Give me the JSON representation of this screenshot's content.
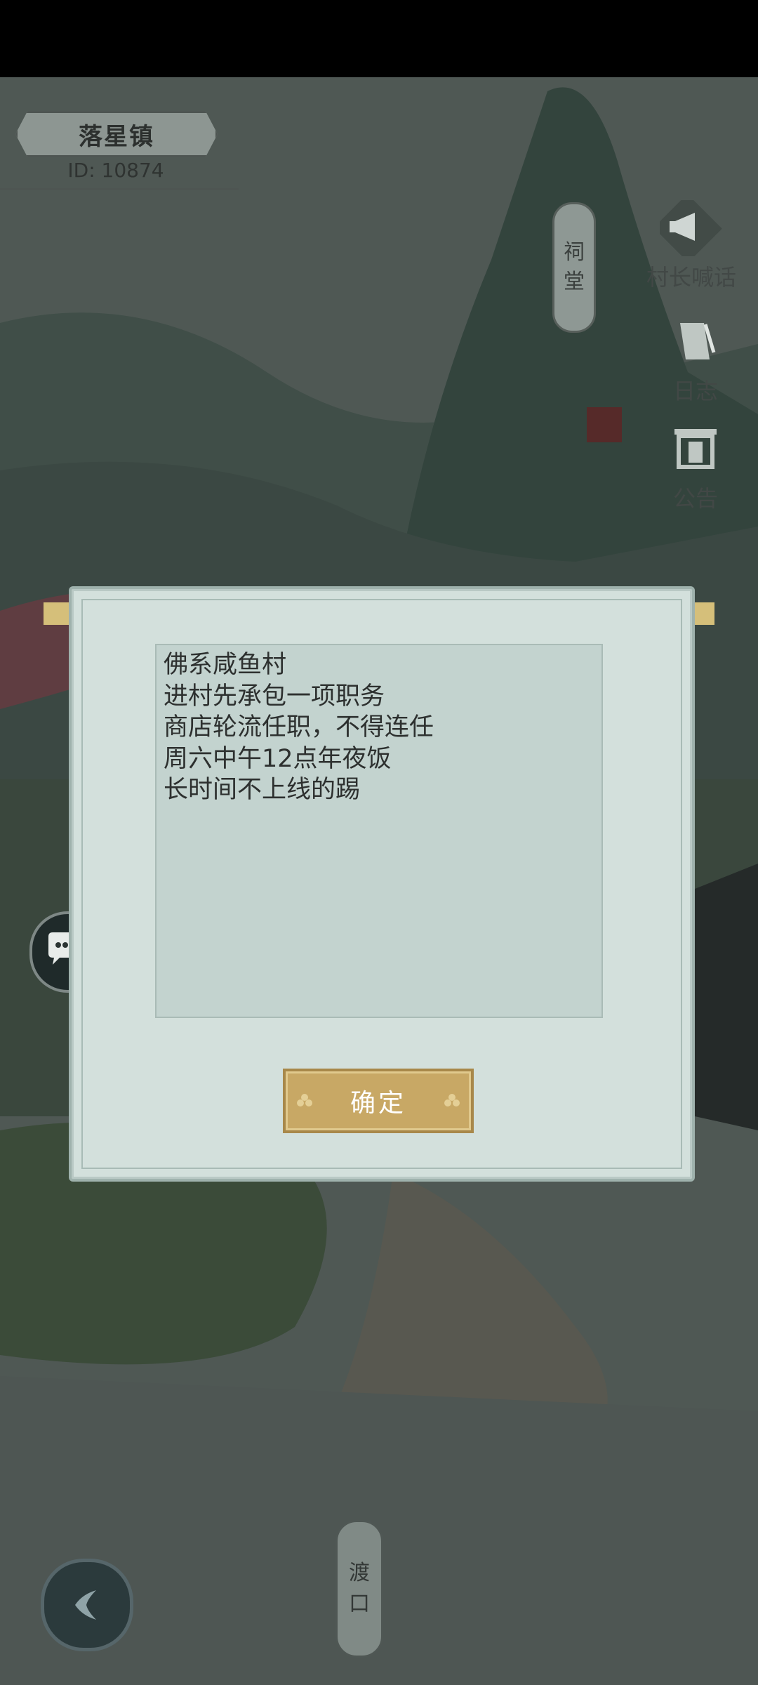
{
  "village": {
    "name": "落星镇",
    "id_text": "ID: 10874"
  },
  "map_labels": {
    "ancestral_hall": [
      "祠",
      "堂"
    ],
    "ferry": [
      "渡",
      "口"
    ]
  },
  "side_buttons": {
    "chief_shout": "村长喊话",
    "log": "日志",
    "announcement": "公告"
  },
  "dialog": {
    "notice_lines": [
      "佛系咸鱼村",
      "进村先承包一项职务",
      "商店轮流任职，不得连任",
      "周六中午12点年夜饭",
      "长时间不上线的踢"
    ],
    "confirm_label": "确定"
  },
  "colors": {
    "dialog_bg": "#d3e0dc",
    "confirm_button": "#c8a865",
    "scene_overlay": "#5f6a66"
  }
}
